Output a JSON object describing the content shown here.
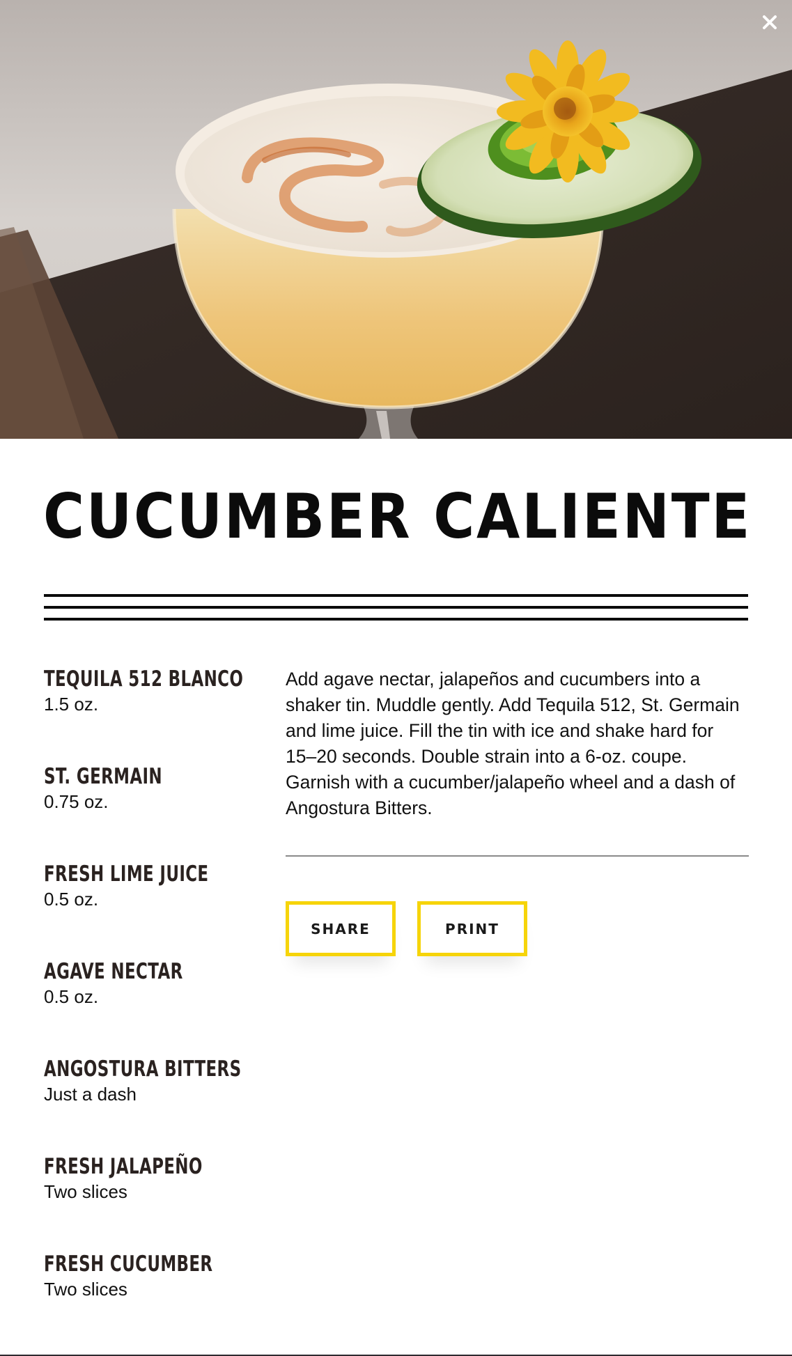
{
  "recipe": {
    "title": "CUCUMBER CALIENTE",
    "ingredients": [
      {
        "name": "TEQUILA 512 BLANCO",
        "amount": "1.5 oz."
      },
      {
        "name": "ST. GERMAIN",
        "amount": "0.75 oz."
      },
      {
        "name": "FRESH LIME JUICE",
        "amount": "0.5 oz."
      },
      {
        "name": "AGAVE NECTAR",
        "amount": "0.5 oz."
      },
      {
        "name": "ANGOSTURA BITTERS",
        "amount": "Just a dash"
      },
      {
        "name": "FRESH JALAPEÑO",
        "amount": "Two slices"
      },
      {
        "name": "FRESH CUCUMBER",
        "amount": "Two slices"
      }
    ],
    "instructions": "Add agave nectar, jalapeños and cucumbers into a shaker tin. Muddle gently. Add Tequila 512, St. Germain and lime juice. Fill the tin with ice and shake hard for 15–20 seconds. Double strain into a 6-oz. coupe. Garnish with a cucumber/jalapeño wheel and a dash of Angostura Bitters."
  },
  "actions": {
    "share_label": "SHARE",
    "print_label": "PRINT"
  },
  "icons": {
    "close": "close-icon"
  },
  "colors": {
    "accent_yellow": "#f6d40a",
    "title_black": "#0b0b0b"
  }
}
